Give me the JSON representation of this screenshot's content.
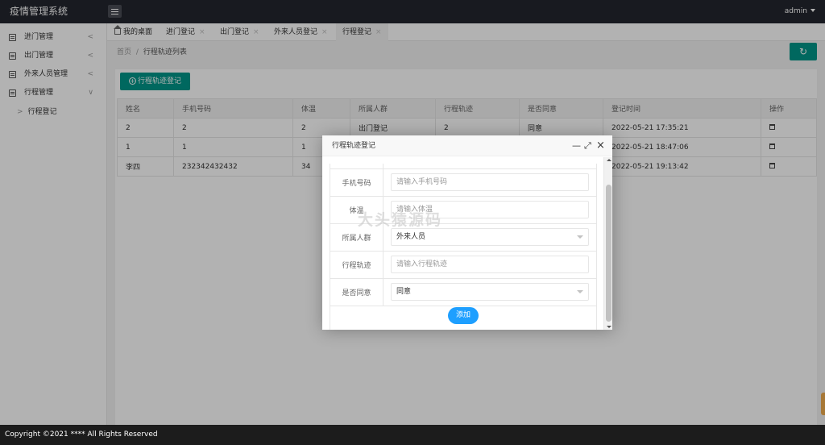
{
  "app": {
    "title": "疫情管理系统",
    "user": "admin"
  },
  "sidebar": {
    "items": [
      {
        "label": "进门管理",
        "arrow": "<"
      },
      {
        "label": "出门管理",
        "arrow": "<"
      },
      {
        "label": "外来人员管理",
        "arrow": "<"
      },
      {
        "label": "行程管理",
        "arrow": "∨"
      }
    ],
    "sub_items": [
      {
        "label": "行程登记",
        "arrow": ">"
      }
    ]
  },
  "tabs": [
    {
      "label": "我的桌面",
      "closable": false
    },
    {
      "label": "进门登记",
      "close": "×"
    },
    {
      "label": "出门登记",
      "close": "×"
    },
    {
      "label": "外来人员登记",
      "close": "×"
    },
    {
      "label": "行程登记",
      "close": "×"
    }
  ],
  "breadcrumb": {
    "home": "首页",
    "sep": "/",
    "current": "行程轨迹列表"
  },
  "toolbar": {
    "add_label": "行程轨迹登记",
    "refresh_icon": "↻"
  },
  "table": {
    "headers": [
      "姓名",
      "手机号码",
      "体温",
      "所属人群",
      "行程轨迹",
      "是否同意",
      "登记时间",
      "操作"
    ],
    "rows": [
      [
        "2",
        "2",
        "2",
        "出门登记",
        "2",
        "同意",
        "2022-05-21 17:35:21"
      ],
      [
        "1",
        "1",
        "1",
        "",
        "",
        "",
        "2022-05-21 18:47:06"
      ],
      [
        "李四",
        "232342432432",
        "34",
        "",
        "",
        "",
        "2022-05-21 19:13:42"
      ]
    ]
  },
  "modal": {
    "title": "行程登记",
    "title_full": "行程轨迹登记",
    "ctrl_min": "—",
    "ctrl_max": "⤢",
    "ctrl_close": "×",
    "fields": [
      {
        "label": "手机号码",
        "placeholder": "请输入手机号码",
        "value": ""
      },
      {
        "label": "体温",
        "placeholder": "请输入体温",
        "value": ""
      },
      {
        "label": "所属人群",
        "placeholder": "",
        "value": "外来人员"
      },
      {
        "label": "行程轨迹",
        "placeholder": "请输入行程轨迹",
        "value": ""
      },
      {
        "label": "是否同意",
        "placeholder": "",
        "value": "同意"
      }
    ],
    "submit_label": "添加"
  },
  "watermark": "大头猿源码",
  "footer": {
    "copyright": "Copyright ©2021 **** All Rights Reserved"
  },
  "colors": {
    "header": "#23262e",
    "accent": "#009688",
    "primary_btn": "#1e9fff",
    "footer": "#1c1c1c"
  }
}
